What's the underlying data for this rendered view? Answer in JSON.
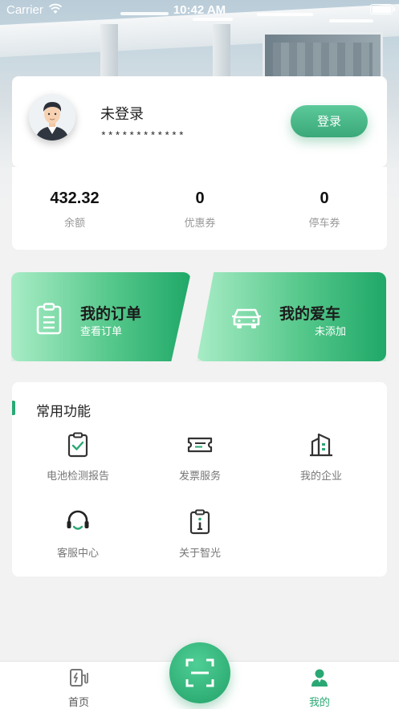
{
  "status_bar": {
    "carrier": "Carrier",
    "time": "10:42 AM"
  },
  "profile": {
    "name": "未登录",
    "account_masked": "************",
    "login_label": "登录"
  },
  "stats": [
    {
      "value": "432.32",
      "label": "余额"
    },
    {
      "value": "0",
      "label": "优惠券"
    },
    {
      "value": "0",
      "label": "停车券"
    }
  ],
  "quick_actions": {
    "orders": {
      "title": "我的订单",
      "subtitle": "查看订单",
      "icon": "clipboard-icon"
    },
    "car": {
      "title": "我的爱车",
      "subtitle": "未添加",
      "icon": "car-icon"
    }
  },
  "functions": {
    "heading": "常用功能",
    "items": [
      {
        "label": "电池检测报告",
        "icon": "clipboard-check-icon"
      },
      {
        "label": "发票服务",
        "icon": "ticket-icon"
      },
      {
        "label": "我的企业",
        "icon": "building-icon"
      },
      {
        "label": "客服中心",
        "icon": "headset-icon"
      },
      {
        "label": "关于智光",
        "icon": "info-document-icon"
      }
    ]
  },
  "tab_bar": {
    "items": [
      {
        "label": "首页",
        "icon": "charging-station-icon",
        "active": false
      },
      {
        "label": "我的",
        "icon": "user-icon",
        "active": true
      }
    ],
    "center_icon": "scan-icon"
  },
  "colors": {
    "accent": "#2aa874",
    "inactive_tab": "#555555",
    "muted": "#999999"
  }
}
